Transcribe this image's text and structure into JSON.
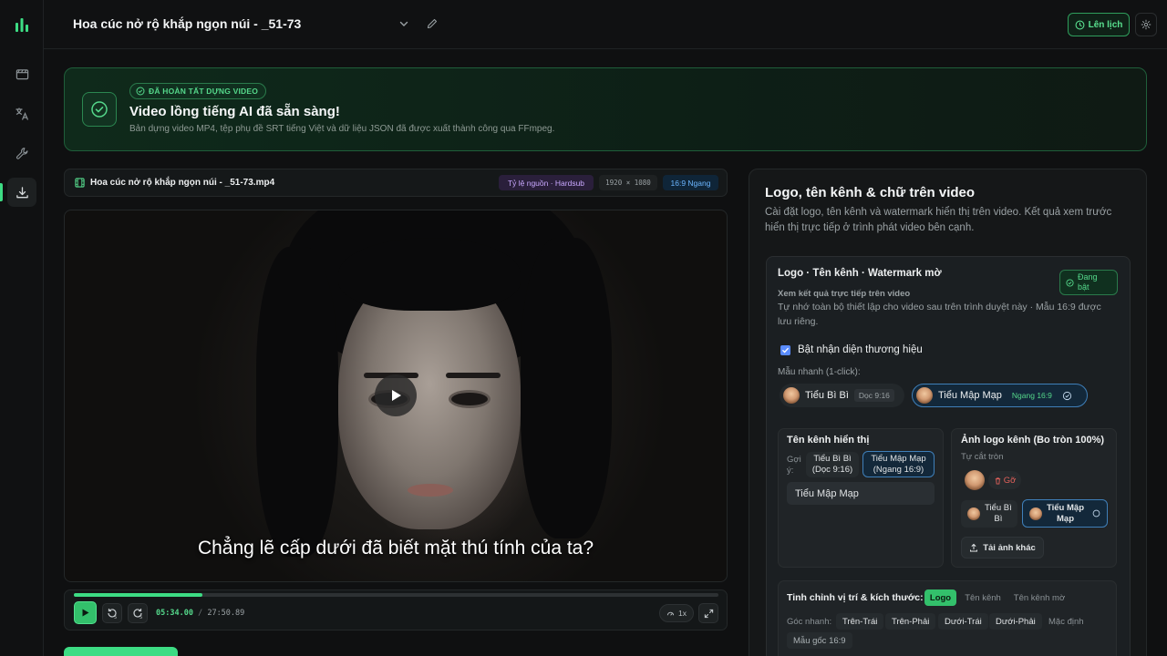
{
  "header": {
    "project_title": "Hoa cúc nở rộ khắp ngọn núi - _51-73",
    "schedule_label": "Lên lịch",
    "icons": [
      "chevron-down-icon",
      "pencil-icon",
      "clock-icon",
      "gear-icon"
    ]
  },
  "sidebar": {
    "items": [
      {
        "icon": "film-icon",
        "active": false
      },
      {
        "icon": "translate-icon",
        "active": false
      },
      {
        "icon": "wrench-icon",
        "active": false
      },
      {
        "icon": "download-icon",
        "active": true
      }
    ],
    "accent": "#3ddc84"
  },
  "banner": {
    "badge": "ĐÃ HOÀN TẤT DỰNG VIDEO",
    "title": "Video lồng tiếng AI đã sẵn sàng!",
    "description": "Bản dựng video MP4, tệp phụ đề SRT tiếng Việt và dữ liệu JSON đã được xuất thành công qua FFmpeg."
  },
  "file": {
    "name": "Hoa cúc nở rộ khắp ngọn núi - _51-73.mp4",
    "source_tag": "Tỷ lệ nguồn · Hardsub",
    "resolution": "1920 × 1080",
    "ratio_tag": "16:9 Ngang"
  },
  "player": {
    "subtitle": "Chẳng lẽ cấp dưới đã biết mặt thú tính của ta?",
    "current_time": "05:34.00",
    "separator": "/",
    "duration": "27:50.89",
    "progress_fraction": 0.2,
    "skip_back": "5",
    "skip_forward": "5",
    "speed": "1x"
  },
  "panel": {
    "title": "Logo, tên kênh & chữ trên video",
    "description": "Cài đặt logo, tên kênh và watermark hiển thị trên video. Kết quả xem trước hiển thị trực tiếp ở trình phát video bên cạnh.",
    "card": {
      "title": "Logo · Tên kênh · Watermark mờ",
      "status_line1": "Đang",
      "status_line2": "bật",
      "subtitle": "Xem kết quả trực tiếp trên video",
      "note": "Tự nhớ toàn bộ thiết lập cho video sau trên trình duyệt này · Mẫu 16:9 được lưu riêng.",
      "brand_toggle": "Bật nhận diện thương hiệu",
      "brand_enabled": true,
      "quick_label": "Mẫu nhanh (1-click):",
      "presets": [
        {
          "name": "Tiểu Bì Bì",
          "tag": "Dọc 9:16",
          "selected": false
        },
        {
          "name": "Tiểu Mập Mạp",
          "tag": "Ngang 16:9",
          "selected": true
        }
      ]
    },
    "channel_name": {
      "title": "Tên kênh hiển thị",
      "suggest_label_1": "Gợi",
      "suggest_label_2": "ý:",
      "suggestion_a_1": "Tiểu Bì Bì",
      "suggestion_a_2": "(Dọc 9:16)",
      "suggestion_b_1": "Tiểu Mập Mạp",
      "suggestion_b_2": "(Ngang 16:9)",
      "value": "Tiểu Mập Mạp"
    },
    "logo": {
      "title": "Ảnh logo kênh (Bo tròn 100%)",
      "hint": "Tự cắt tròn",
      "remove": "Gỡ",
      "option_a_1": "Tiểu Bì",
      "option_a_2": "Bì",
      "option_b_1": "Tiểu Mập",
      "option_b_2": "Mạp",
      "upload": "Tải ảnh khác"
    },
    "tune": {
      "title": "Tinh chỉnh vị trí & kích thước:",
      "tabs": [
        "Logo",
        "Tên kênh",
        "Tên kênh mờ"
      ],
      "active_tab": "Logo",
      "corner_label": "Góc nhanh:",
      "corners": [
        "Trên-Trái",
        "Trên-Phải",
        "Dưới-Trái",
        "Dưới-Phải",
        "Mặc định"
      ],
      "preset_169": "Mẫu gốc 16:9"
    }
  }
}
